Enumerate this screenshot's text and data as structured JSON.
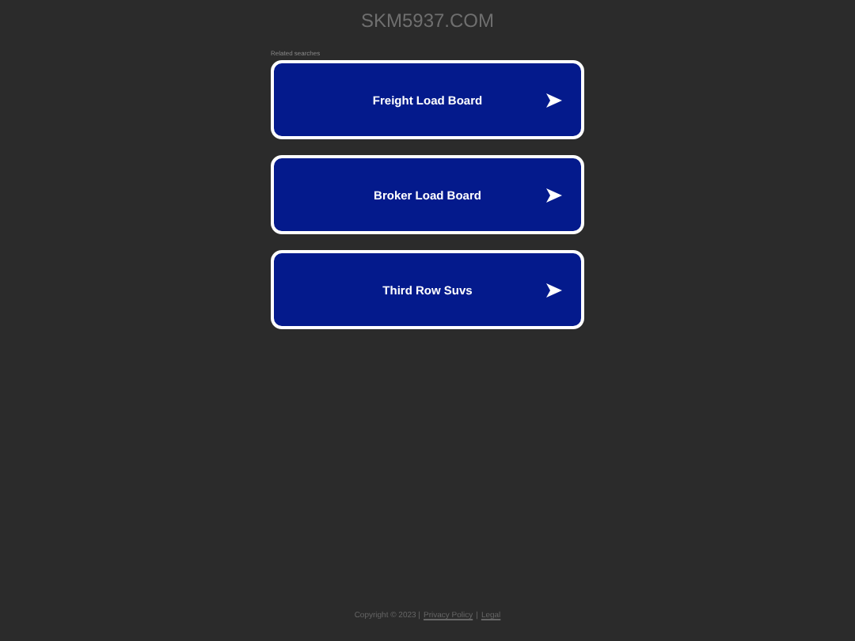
{
  "site_title": "SKM5937.COM",
  "related_label": "Related searches",
  "links": [
    {
      "label": "Freight Load Board"
    },
    {
      "label": "Broker Load Board"
    },
    {
      "label": "Third Row Suvs"
    }
  ],
  "footer": [
    {
      "kind": "text",
      "text": "Copyright © 2023 |"
    },
    {
      "kind": "link",
      "text": "Privacy Policy"
    },
    {
      "kind": "text",
      "text": "|"
    },
    {
      "kind": "link",
      "text": "Legal"
    }
  ]
}
